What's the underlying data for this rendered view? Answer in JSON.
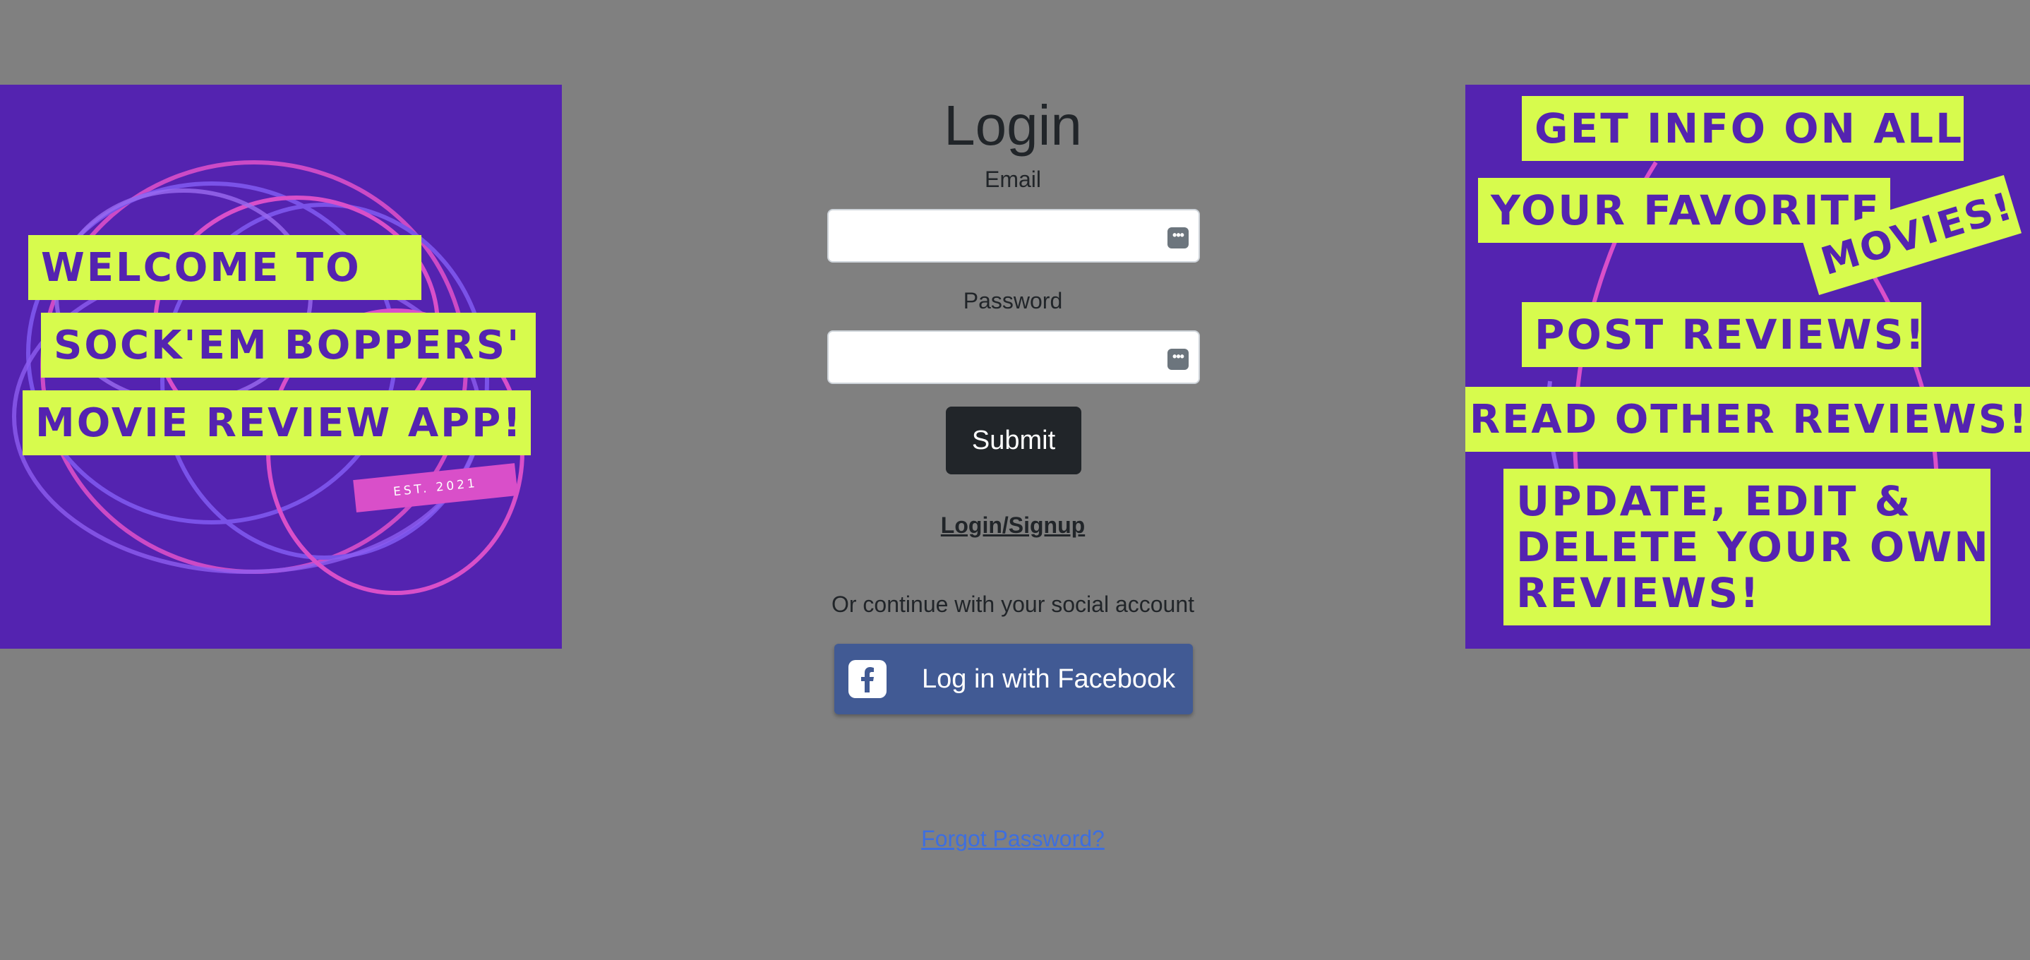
{
  "login": {
    "title": "Login",
    "email_label": "Email",
    "email_value": "",
    "password_label": "Password",
    "password_value": "",
    "submit_label": "Submit",
    "nav_link": "Login/Signup",
    "social_prompt": "Or continue with your social account",
    "facebook_label": "Log in with Facebook",
    "forgot_password": "Forgot Password?"
  },
  "left_promo": {
    "line1": "WELCOME TO",
    "line2": "SOCK'EM BOPPERS'",
    "line3": "MOVIE REVIEW APP!",
    "tag": "EST. 2021"
  },
  "right_promo": {
    "line1": "GET INFO ON ALL",
    "line2": "YOUR FAVORITE",
    "line3": "MOVIES!",
    "line4": "POST REVIEWS!",
    "line5": "READ OTHER REVIEWS!",
    "line6a": "UPDATE, EDIT &",
    "line6b": "DELETE YOUR OWN",
    "line6c": "REVIEWS!"
  },
  "colors": {
    "background": "#808080",
    "promo_purple": "#5423b0",
    "promo_lime": "#d7fb4d",
    "promo_pink": "#d94fc9",
    "facebook_blue": "#415a94",
    "link_blue": "#3d6ee0"
  },
  "icons": {
    "input_key": "key-icon",
    "facebook": "facebook-icon"
  }
}
